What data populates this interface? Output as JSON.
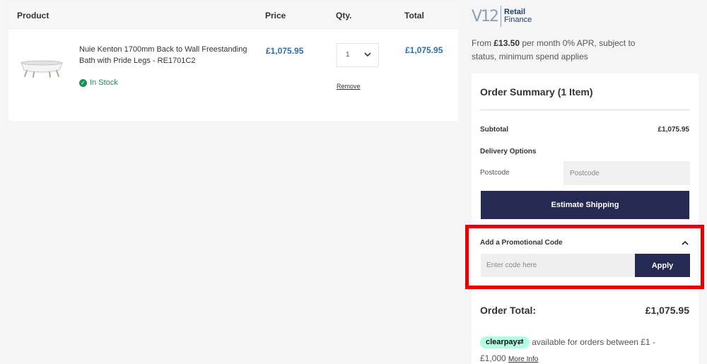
{
  "cart": {
    "headers": {
      "product": "Product",
      "price": "Price",
      "qty": "Qty.",
      "total": "Total"
    },
    "item": {
      "name": "Nuie Kenton 1700mm Back to Wall Freestanding Bath with Pride Legs - RE1701C2",
      "stock": "In Stock",
      "price": "£1,075.95",
      "qty": "1",
      "total": "£1,075.95",
      "remove": "Remove"
    }
  },
  "finance": {
    "logo_mark": "V12",
    "logo_line1": "Retail",
    "logo_line2": "Finance",
    "text_prefix": "From ",
    "amount": "£13.50",
    "text_suffix": " per month 0% APR, subject to status, minimum spend applies"
  },
  "summary": {
    "title": "Order Summary (1 Item)",
    "subtotal_label": "Subtotal",
    "subtotal_value": "£1,075.95",
    "delivery_label": "Delivery Options",
    "postcode_label": "Postcode",
    "postcode_placeholder": "Postcode",
    "estimate_button": "Estimate Shipping",
    "promo_label": "Add a Promotional Code",
    "promo_placeholder": "Enter code here",
    "apply_button": "Apply",
    "order_total_label": "Order Total:",
    "order_total_value": "£1,075.95",
    "clearpay_badge": "clearpay",
    "clearpay_text": " available for orders between £1 - £1,000 ",
    "more_info": "More Info"
  },
  "colors": {
    "brand_navy": "#242a52",
    "price_blue": "#2a6fb0",
    "stock_green": "#1e8e5a",
    "highlight_red": "#e60000",
    "clearpay_mint": "#b2fce4"
  },
  "icons": [
    "check-circle-icon",
    "chevron-down-icon",
    "chevron-up-icon",
    "clearpay-arrows-icon"
  ]
}
